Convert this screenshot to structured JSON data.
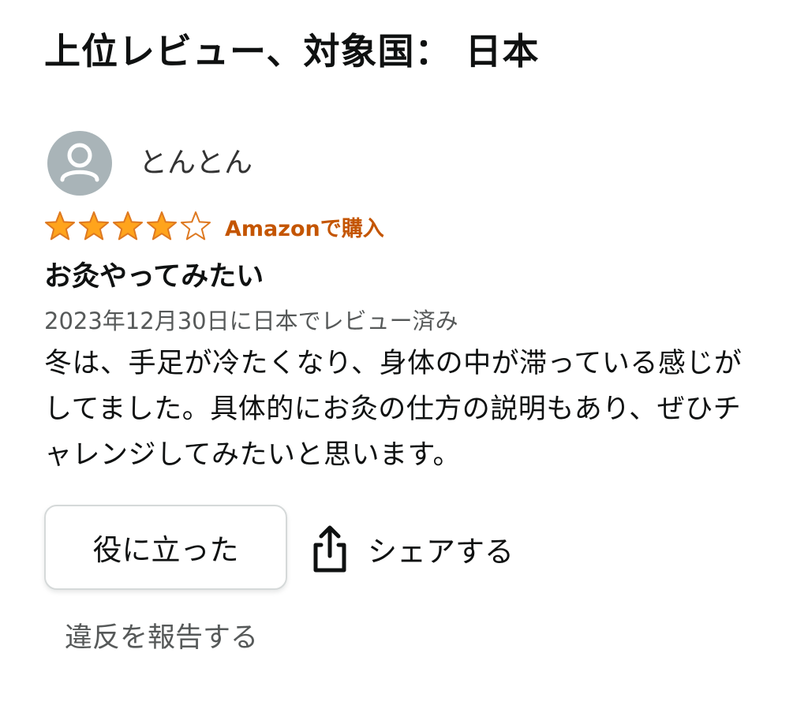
{
  "header": {
    "title": "上位レビュー、対象国： 日本"
  },
  "review": {
    "reviewer": {
      "name": "とんとん",
      "avatar_icon": "default-user-avatar-icon"
    },
    "rating": 4,
    "rating_max": 5,
    "verified_label": "Amazonで購入",
    "title": "お灸やってみたい",
    "date_text": "2023年12月30日に日本でレビュー済み",
    "body": "冬は、手足が冷たくなり、身体の中が滞っている感じがしてました。具体的にお灸の仕方の説明もあり、ぜひチャレンジしてみたいと思います。"
  },
  "actions": {
    "helpful_label": "役に立った",
    "share_label": "シェアする",
    "share_icon": "share-icon",
    "report_label": "違反を報告する"
  },
  "colors": {
    "star_fill": "#ffa41c",
    "star_stroke": "#de7921",
    "verified": "#c45500",
    "avatar_bg": "#a9b4b8",
    "muted_text": "#565959",
    "button_border": "#d5d9d9"
  }
}
